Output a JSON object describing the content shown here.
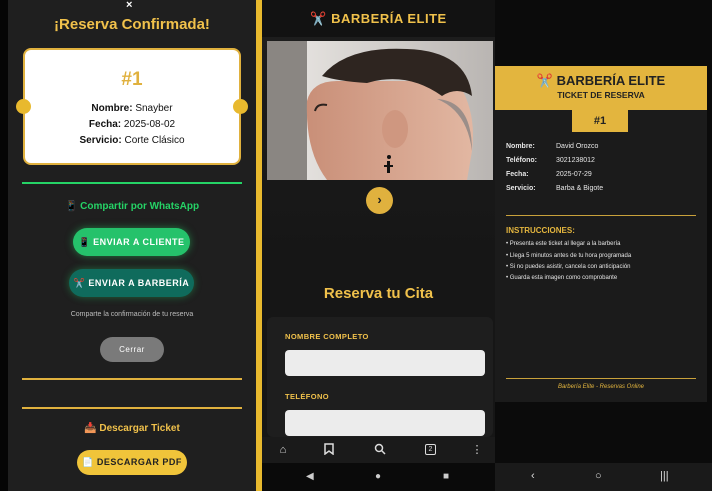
{
  "modal": {
    "close_glyph": "×",
    "title": "¡Reserva Confirmada!",
    "ticket_number": "#1",
    "fields": [
      {
        "label": "Nombre:",
        "value": "Snayber"
      },
      {
        "label": "Fecha:",
        "value": "2025-08-02"
      },
      {
        "label": "Servicio:",
        "value": "Corte Clásico"
      }
    ],
    "whatsapp_title": "📱 Compartir por WhatsApp",
    "send_client_label": "📱 ENVIAR A CLIENTE",
    "send_barber_label": "✂️ ENVIAR A BARBERÍA",
    "share_hint": "Comparte la confirmación de tu reserva",
    "close_label": "Cerrar",
    "download_title": "📥 Descargar Ticket",
    "download_pdf_label": "📄 DESCARGAR PDF"
  },
  "booking": {
    "brand": "✂️ BARBERÍA ELITE",
    "slider_next": "›",
    "section_title": "Reserva tu Cita",
    "name_label": "NOMBRE COMPLETO",
    "phone_label": "TELÉFONO",
    "name_value": "",
    "phone_value": "",
    "tabs_count": "2"
  },
  "ticket": {
    "title": "✂️ BARBERÍA ELITE",
    "subtitle": "TICKET DE RESERVA",
    "number": "#1",
    "fields": [
      {
        "label": "Nombre:",
        "value": "David Orozco"
      },
      {
        "label": "Teléfono:",
        "value": "3021238012"
      },
      {
        "label": "Fecha:",
        "value": "2025-07-29"
      },
      {
        "label": "Servicio:",
        "value": "Barba & Bigote"
      }
    ],
    "instructions_title": "INSTRUCCIONES:",
    "instructions": [
      "• Presenta este ticket al llegar a la barbería",
      "• Llega 5 minutos antes de tu hora programada",
      "• Si no puedes asistir, cancela con anticipación",
      "• Guarda esta imagen como comprobante"
    ],
    "footer": "Barbería Elite - Reservas Online"
  },
  "colors": {
    "gold": "#e0b13e",
    "whatsapp": "#25d366",
    "dark": "#1f1f1f"
  }
}
